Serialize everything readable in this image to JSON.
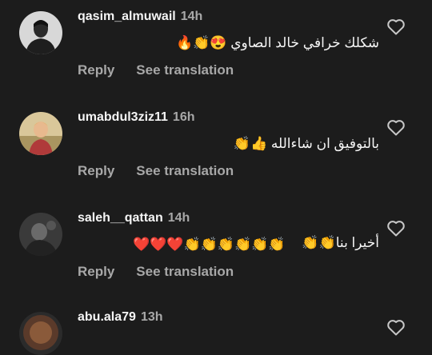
{
  "comments": [
    {
      "username": "qasim_almuwail",
      "time": "14h",
      "text": "شكلك خرافي خالد الصاوي 😍👏🔥",
      "reply_label": "Reply",
      "translate_label": "See translation",
      "like_icon": "heart-outline-icon"
    },
    {
      "username": "umabdul3ziz11",
      "time": "16h",
      "text": "بالتوفيق ان شاءالله 👍👏",
      "reply_label": "Reply",
      "translate_label": "See translation",
      "like_icon": "heart-outline-icon"
    },
    {
      "username": "saleh__qattan",
      "time": "14h",
      "text_line1": "أخيرا بنا👏👏",
      "text_line2": "❤️❤️❤️👏👏👏👏👏👏",
      "reply_label": "Reply",
      "translate_label": "See translation",
      "like_icon": "heart-outline-icon"
    },
    {
      "username": "abu.ala79",
      "time": "13h",
      "like_icon": "heart-outline-icon"
    }
  ],
  "colors": {
    "background": "#1c1c1c",
    "primary_text": "#f5f5f5",
    "secondary_text": "#a8a8a8"
  }
}
